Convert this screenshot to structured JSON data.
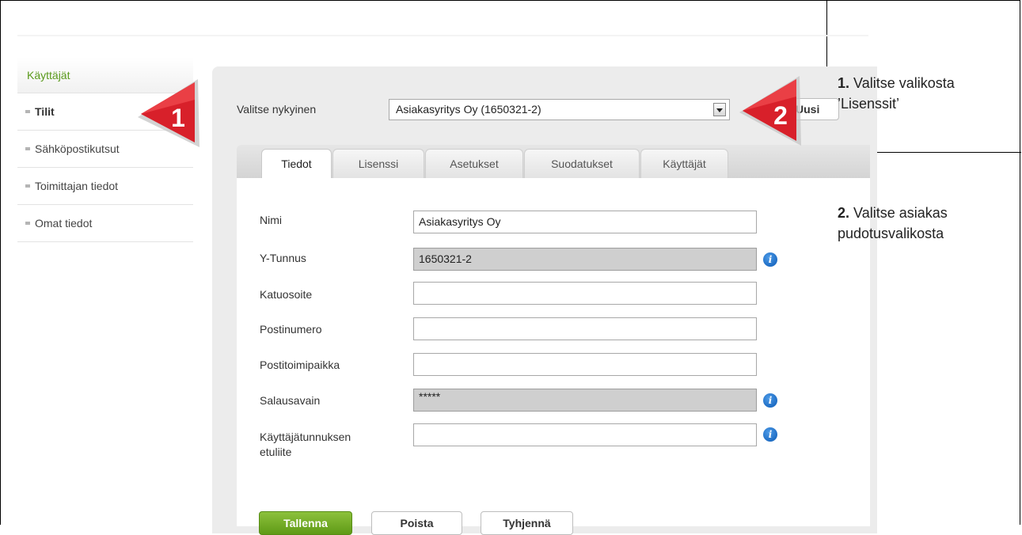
{
  "sidebar": {
    "header": "Käyttäjät",
    "items": [
      {
        "label": "Tilit",
        "active": true
      },
      {
        "label": "Sähköpostikutsut",
        "active": false
      },
      {
        "label": "Toimittajan tiedot",
        "active": false
      },
      {
        "label": "Omat tiedot",
        "active": false
      }
    ]
  },
  "selector": {
    "label": "Valitse nykyinen",
    "value": "Asiakasyritys Oy (1650321-2)",
    "new_button": "Uusi"
  },
  "tabs": [
    "Tiedot",
    "Lisenssi",
    "Asetukset",
    "Suodatukset",
    "Käyttäjät"
  ],
  "active_tab": "Tiedot",
  "form": {
    "name_label": "Nimi",
    "name_value": "Asiakasyritys Oy",
    "ytunnus_label": "Y-Tunnus",
    "ytunnus_value": "1650321-2",
    "street_label": "Katuosoite",
    "street_value": "",
    "postcode_label": "Postinumero",
    "postcode_value": "",
    "city_label": "Postitoimipaikka",
    "city_value": "",
    "key_label": "Salausavain",
    "key_value": "*****",
    "prefix_label_1": "Käyttäjätunnuksen",
    "prefix_label_2": "etuliite",
    "prefix_value": ""
  },
  "buttons": {
    "save": "Tallenna",
    "delete": "Poista",
    "clear": "Tyhjennä"
  },
  "callouts": {
    "one": "1",
    "two": "2"
  },
  "notes": {
    "n1_num": "1.",
    "n1_text_a": "Valitse valikosta",
    "n1_text_b": "’Lisenssit’",
    "n2_num": "2.",
    "n2_text_a": "Valitse asiakas",
    "n2_text_b": "pudotusvalikosta"
  },
  "colors": {
    "accent_green": "#6aa51f",
    "callout_red": "#d8202a",
    "info_blue": "#1a6fd0"
  }
}
